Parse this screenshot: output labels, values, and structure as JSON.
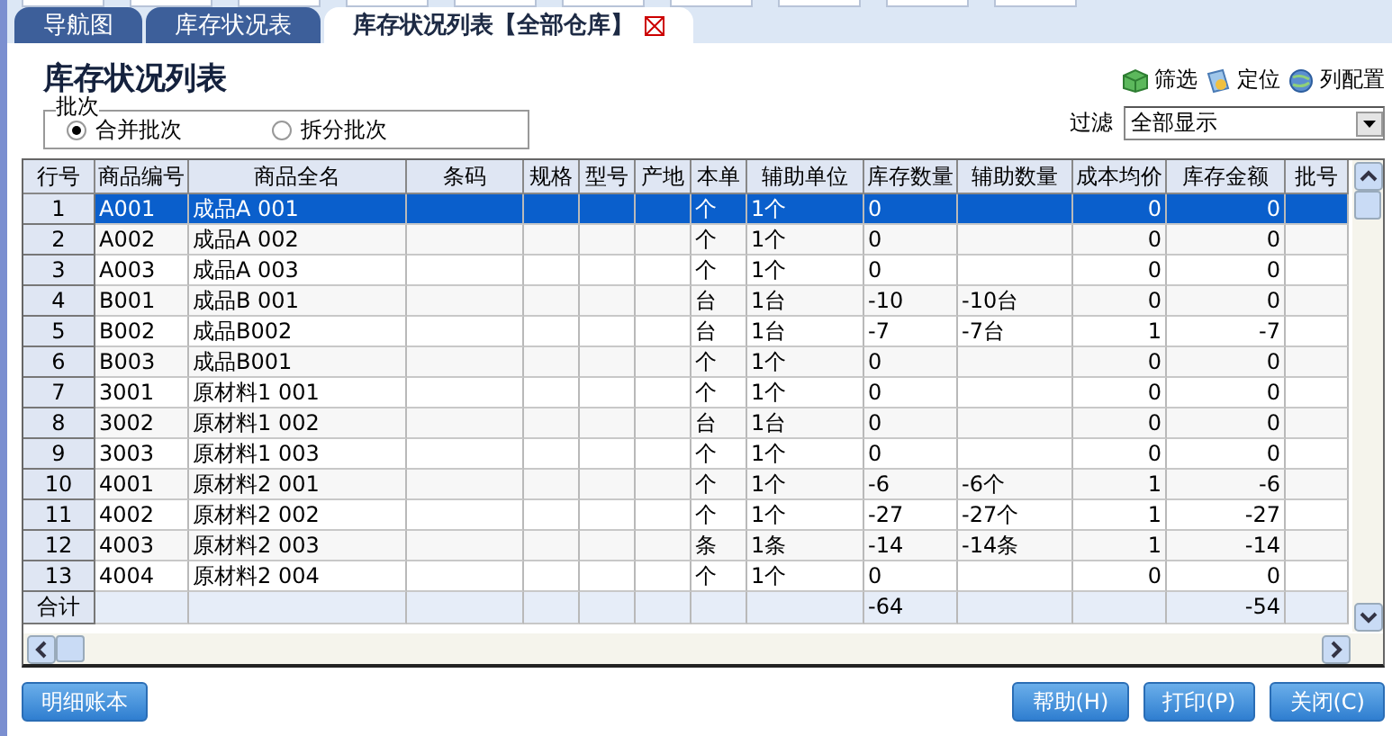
{
  "tabs": [
    {
      "label": "导航图",
      "selected": false
    },
    {
      "label": "库存状况表",
      "selected": false
    },
    {
      "label": "库存状况列表【全部仓库】",
      "selected": true
    }
  ],
  "title": "库存状况列表",
  "batch_group": {
    "legend": "批次",
    "options": [
      {
        "label": "合并批次",
        "selected": true
      },
      {
        "label": "拆分批次",
        "selected": false
      }
    ]
  },
  "toolbar": [
    {
      "kind": "filter",
      "label": "筛选"
    },
    {
      "kind": "locate",
      "label": "定位"
    },
    {
      "kind": "columns",
      "label": "列配置"
    }
  ],
  "filter": {
    "label": "过滤",
    "value": "全部显示"
  },
  "table": {
    "columns": [
      "行号",
      "商品编号",
      "商品全名",
      "条码",
      "规格",
      "型号",
      "产地",
      "本单",
      "辅助单位",
      "库存数量",
      "辅助数量",
      "成本均价",
      "库存金额",
      "批号"
    ],
    "rows": [
      {
        "no": "1",
        "code": "A001",
        "name": "成品A 001",
        "unit": "个",
        "aux_unit": "1个",
        "qty": "0",
        "cost": "0",
        "amount": "0",
        "selected": true
      },
      {
        "no": "2",
        "code": "A002",
        "name": "成品A 002",
        "unit": "个",
        "aux_unit": "1个",
        "qty": "0",
        "cost": "0",
        "amount": "0",
        "selected": false
      },
      {
        "no": "3",
        "code": "A003",
        "name": "成品A 003",
        "unit": "个",
        "aux_unit": "1个",
        "qty": "0",
        "cost": "0",
        "amount": "0",
        "selected": false
      },
      {
        "no": "4",
        "code": "B001",
        "name": "成品B 001",
        "unit": "台",
        "aux_unit": "1台",
        "qty": "-10",
        "aux_qty": "-10台",
        "cost": "0",
        "amount": "0",
        "selected": false
      },
      {
        "no": "5",
        "code": "B002",
        "name": "成品B002",
        "unit": "台",
        "aux_unit": "1台",
        "qty": "-7",
        "aux_qty": "-7台",
        "cost": "1",
        "amount": "-7",
        "selected": false
      },
      {
        "no": "6",
        "code": "B003",
        "name": "成品B001",
        "unit": "个",
        "aux_unit": "1个",
        "qty": "0",
        "cost": "0",
        "amount": "0",
        "selected": false
      },
      {
        "no": "7",
        "code": "3001",
        "name": "原材料1 001",
        "unit": "个",
        "aux_unit": "1个",
        "qty": "0",
        "cost": "0",
        "amount": "0",
        "selected": false
      },
      {
        "no": "8",
        "code": "3002",
        "name": "原材料1 002",
        "unit": "台",
        "aux_unit": "1台",
        "qty": "0",
        "cost": "0",
        "amount": "0",
        "selected": false
      },
      {
        "no": "9",
        "code": "3003",
        "name": "原材料1 003",
        "unit": "个",
        "aux_unit": "1个",
        "qty": "0",
        "cost": "0",
        "amount": "0",
        "selected": false
      },
      {
        "no": "10",
        "code": "4001",
        "name": "原材料2 001",
        "unit": "个",
        "aux_unit": "1个",
        "qty": "-6",
        "aux_qty": "-6个",
        "cost": "1",
        "amount": "-6",
        "selected": false
      },
      {
        "no": "11",
        "code": "4002",
        "name": "原材料2 002",
        "unit": "个",
        "aux_unit": "1个",
        "qty": "-27",
        "aux_qty": "-27个",
        "cost": "1",
        "amount": "-27",
        "selected": false
      },
      {
        "no": "12",
        "code": "4003",
        "name": "原材料2 003",
        "unit": "条",
        "aux_unit": "1条",
        "qty": "-14",
        "aux_qty": "-14条",
        "cost": "1",
        "amount": "-14",
        "selected": false
      },
      {
        "no": "13",
        "code": "4004",
        "name": "原材料2 004",
        "unit": "个",
        "aux_unit": "1个",
        "qty": "0",
        "cost": "0",
        "amount": "0",
        "selected": false
      }
    ],
    "total": {
      "label": "合计",
      "qty": "-64",
      "amount": "-54"
    }
  },
  "left_buttons": [
    "明细账本"
  ],
  "right_buttons": [
    "帮助(H)",
    "打印(P)",
    "关闭(C)"
  ]
}
